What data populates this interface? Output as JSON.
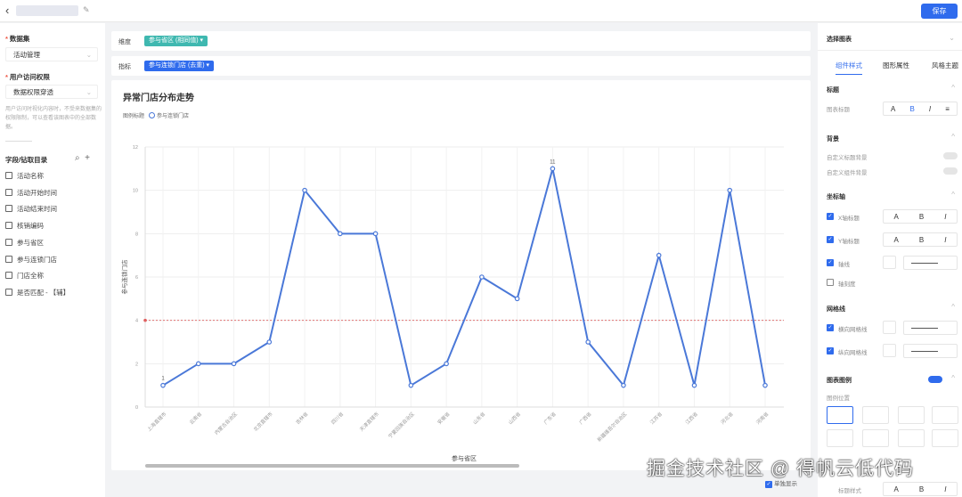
{
  "topbar": {
    "save_label": "保存"
  },
  "left": {
    "dataset_label": "数据集",
    "dataset_value": "活动管理",
    "perm_label": "用户访问权限",
    "perm_value": "数据权限穿透",
    "perm_hint": "用户访问时视化内容时，不受来数据集的权限限制，可以查看该图表中的全部数据。",
    "fields_title": "字段/钻取目录",
    "fields": [
      "活动名称",
      "活动开始时间",
      "活动结束时间",
      "核销编码",
      "参与省区",
      "参与连锁门店",
      "门店全称",
      "是否匹配 - 【辅】"
    ]
  },
  "dimension": {
    "label": "维度",
    "chip": "参与省区 (相同值) ▾"
  },
  "metric": {
    "label": "指标",
    "chip": "参与连锁门店 (去重) ▾"
  },
  "colors": {
    "dim_chip": "#3fb8b0",
    "metric_chip": "#2f6bed",
    "line": "#4a78d8",
    "ref": "#e06060"
  },
  "chart_data": {
    "type": "line",
    "title": "异常门店分布走势",
    "legend_title": "图例标题",
    "legend": [
      "参与连锁门店"
    ],
    "xlabel": "参与省区",
    "ylabel": "参与连锁门店",
    "ylim": [
      0,
      12
    ],
    "yticks": [
      0,
      2,
      4,
      6,
      8,
      10,
      12
    ],
    "reference_line": 4,
    "categories": [
      "上海直辖市",
      "云南省",
      "内蒙古自治区",
      "北京直辖市",
      "吉林省",
      "四川省",
      "天津直辖市",
      "宁夏回族自治区",
      "安徽省",
      "山东省",
      "山西省",
      "广东省",
      "广西省",
      "新疆维吾尔自治区",
      "江苏省",
      "江西省",
      "河北省",
      "河南省"
    ],
    "series": [
      {
        "name": "参与连锁门店",
        "values": [
          1,
          2,
          2,
          3,
          10,
          8,
          8,
          1,
          2,
          6,
          5,
          11,
          3,
          1,
          7,
          1,
          10,
          1
        ]
      }
    ],
    "data_labels": {
      "0": "1",
      "11": "11"
    }
  },
  "right": {
    "select_chart": "选择图表",
    "tabs": [
      "组件样式",
      "图形属性",
      "风格主题"
    ],
    "title_sec": "标题",
    "chart_title": "图表标题",
    "bg_sec": "背景",
    "bg1": "自定义标题背景",
    "bg2": "自定义组件背景",
    "axis_sec": "坐标轴",
    "x_title": "X轴标题",
    "y_title": "Y轴标题",
    "axis_line": "轴线",
    "axis_tick": "轴刻度",
    "grid_sec": "网格线",
    "h_grid": "横向网格线",
    "v_grid": "纵向网格线",
    "legend_sec": "图表图例",
    "legend_pos": "图例位置",
    "show_alone": "单独显示",
    "title_style": "标题样式"
  },
  "watermark": "掘金技术社区 @ 得帆云低代码"
}
